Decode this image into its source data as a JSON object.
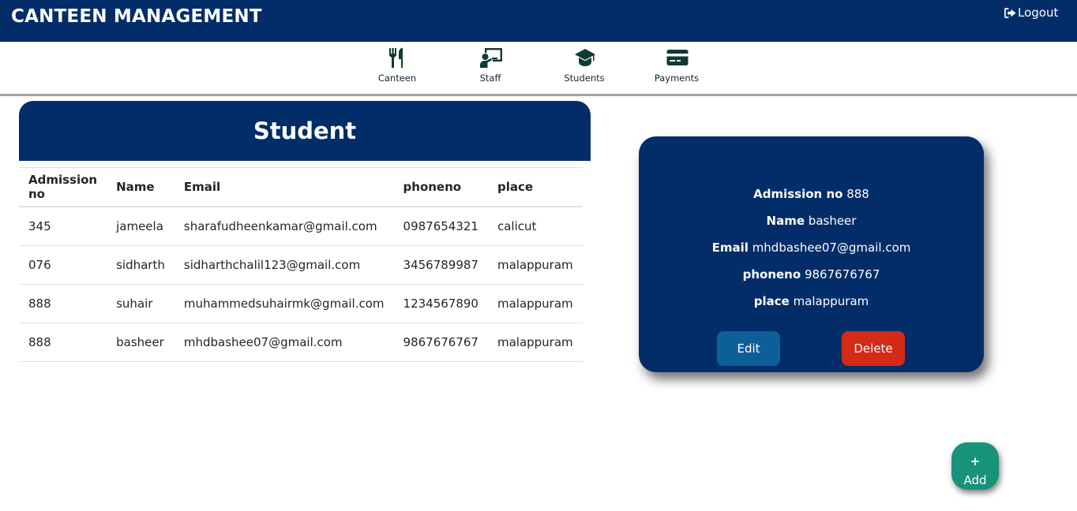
{
  "header": {
    "title": "CANTEEN MANAGEMENT",
    "logout_label": "Logout"
  },
  "nav": {
    "items": [
      {
        "label": "Canteen",
        "icon": "utensils-icon"
      },
      {
        "label": "Staff",
        "icon": "chalkboard-teacher-icon"
      },
      {
        "label": "Students",
        "icon": "graduation-cap-icon"
      },
      {
        "label": "Payments",
        "icon": "credit-card-icon"
      }
    ]
  },
  "student_section": {
    "title": "Student",
    "columns": [
      "Admission no",
      "Name",
      "Email",
      "phoneno",
      "place"
    ],
    "rows": [
      [
        "345",
        "jameela",
        "sharafudheenkamar@gmail.com",
        "0987654321",
        "calicut"
      ],
      [
        "076",
        "sidharth",
        "sidharthchalil123@gmail.com",
        "3456789987",
        "malappuram"
      ],
      [
        "888",
        "suhair",
        "muhammedsuhairmk@gmail.com",
        "1234567890",
        "malappuram"
      ],
      [
        "888",
        "basheer",
        "mhdbashee07@gmail.com",
        "9867676767",
        "malappuram"
      ]
    ]
  },
  "detail": {
    "fields": [
      {
        "label": "Admission no",
        "value": "888"
      },
      {
        "label": "Name",
        "value": "basheer"
      },
      {
        "label": "Email",
        "value": "mhdbashee07@gmail.com"
      },
      {
        "label": "phoneno",
        "value": "9867676767"
      },
      {
        "label": "place",
        "value": "malappuram"
      }
    ],
    "edit_label": "Edit",
    "delete_label": "Delete"
  },
  "fab": {
    "plus": "+",
    "label": "Add"
  },
  "colors": {
    "primary": "#032d68",
    "edit": "#0d5f9a",
    "delete": "#d42a16",
    "fab": "#17927b",
    "icon": "#0e3b33"
  }
}
